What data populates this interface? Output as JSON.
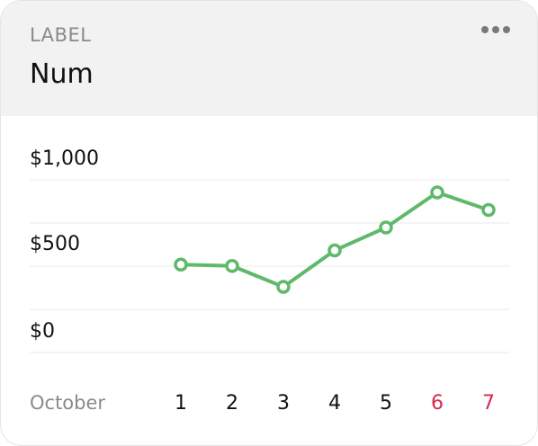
{
  "card": {
    "label": "LABEL",
    "title": "Num"
  },
  "menu": {
    "icon": "more-horizontal-icon"
  },
  "colors": {
    "line": "#5fb96a",
    "weekend": "#d8284f",
    "text": "#111111",
    "muted": "#8a8a8a",
    "grid": "#e8e8e8",
    "header_bg": "#f2f2f2"
  },
  "chart_data": {
    "type": "line",
    "title": "",
    "xlabel": "",
    "ylabel": "",
    "month_label": "October",
    "categories": [
      "1",
      "2",
      "3",
      "4",
      "5",
      "6",
      "7"
    ],
    "highlighted_categories": [
      "6",
      "7"
    ],
    "y_ticks": [
      {
        "value": 1000,
        "label": "$1,000"
      },
      {
        "value": 500,
        "label": "$500"
      },
      {
        "value": 0,
        "label": "$0"
      }
    ],
    "ylim": [
      0,
      1000
    ],
    "grid": true,
    "series": [
      {
        "values": [
          465,
          455,
          300,
          570,
          740,
          1000,
          870
        ]
      }
    ]
  }
}
